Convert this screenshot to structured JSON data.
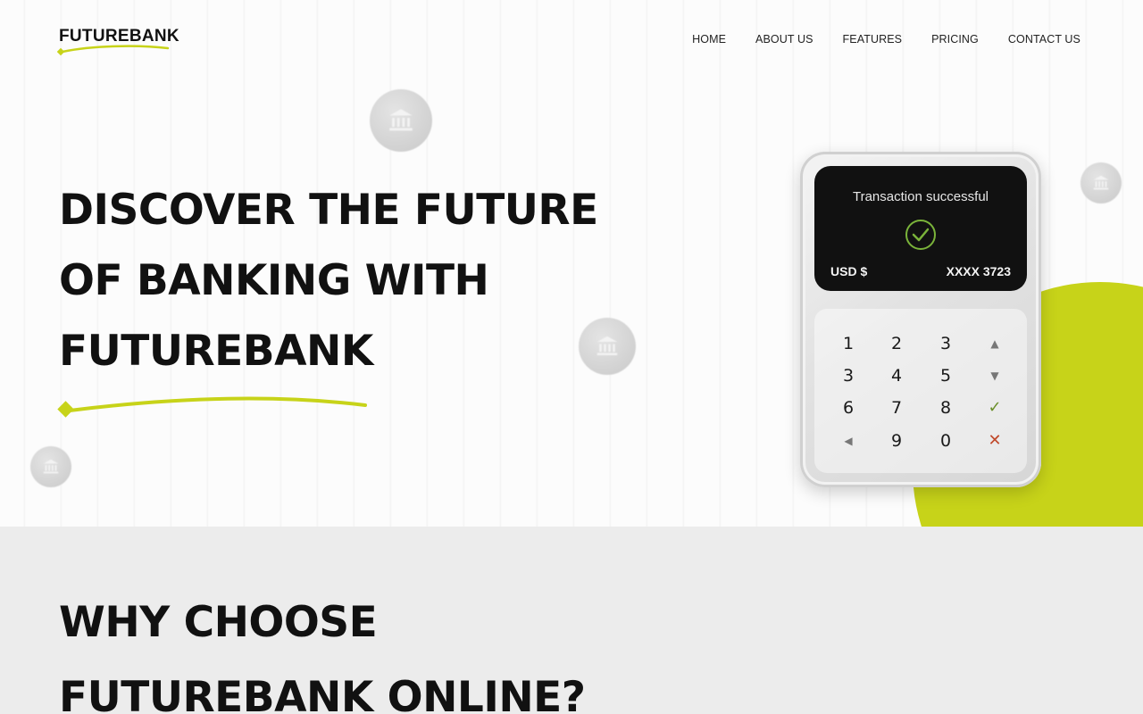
{
  "header": {
    "logo_text": "FUTUREBANK",
    "nav": [
      "HOME",
      "ABOUT US",
      "FEATURES",
      "PRICING",
      "CONTACT US"
    ]
  },
  "hero": {
    "title_lines": [
      "DISCOVER THE FUTURE",
      "OF BANKING WITH",
      "FUTUREBANK"
    ],
    "accent_color": "#c7d319"
  },
  "terminal": {
    "message": "Transaction successful",
    "currency": "USD $",
    "card": "XXXX 3723",
    "keys": [
      "1",
      "2",
      "3",
      "▲",
      "3",
      "4",
      "5",
      "▼",
      "6",
      "7",
      "8",
      "✓",
      "◀",
      "9",
      "0",
      "✕"
    ]
  },
  "section2": {
    "title_lines": [
      "WHY CHOOSE",
      "FUTUREBANK ONLINE?"
    ]
  },
  "icons": {
    "badge": "bank-icon",
    "check": "check-icon"
  }
}
